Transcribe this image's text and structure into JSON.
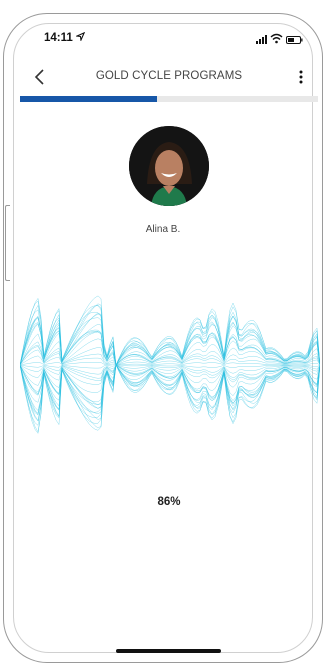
{
  "status_bar": {
    "time": "14:11",
    "location_icon": "location-arrow-icon"
  },
  "nav": {
    "title": "GOLD CYCLE PROGRAMS"
  },
  "progress": {
    "fraction": 0.46
  },
  "coach": {
    "name": "Alina B."
  },
  "audio": {
    "percent_label": "86%"
  },
  "colors": {
    "accent": "#1757a8",
    "wave": "#29c0e0"
  }
}
